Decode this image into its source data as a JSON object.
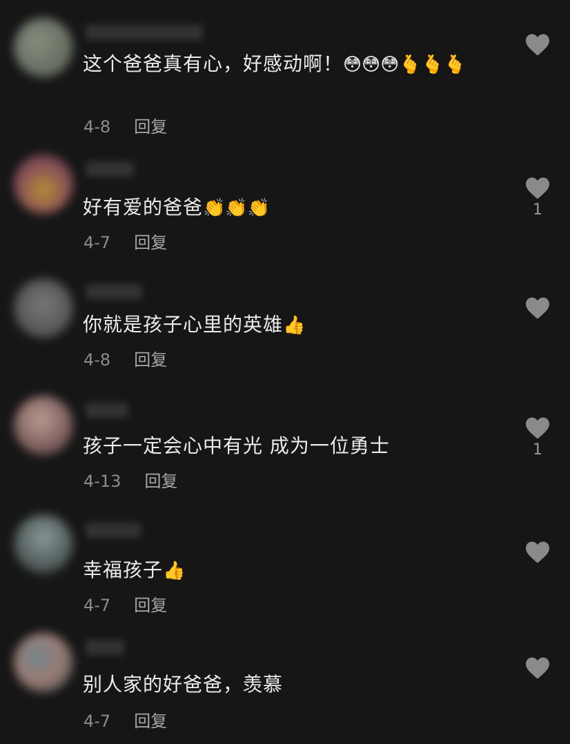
{
  "comments": [
    {
      "text": "这个爸爸真有心，好感动啊！",
      "emojis": "😳😳😳🫰🫰🫰",
      "date": "4-8",
      "reply_label": "回复",
      "like_count": ""
    },
    {
      "text": "好有爱的爸爸",
      "emojis": "👏👏👏",
      "date": "4-7",
      "reply_label": "回复",
      "like_count": "1"
    },
    {
      "text": "你就是孩子心里的英雄",
      "emojis": "👍",
      "date": "4-8",
      "reply_label": "回复",
      "like_count": ""
    },
    {
      "text": "孩子一定会心中有光 成为一位勇士",
      "emojis": "",
      "date": "4-13",
      "reply_label": "回复",
      "like_count": "1"
    },
    {
      "text": "幸福孩子",
      "emojis": "👍",
      "date": "4-7",
      "reply_label": "回复",
      "like_count": ""
    },
    {
      "text": "别人家的好爸爸，羡慕",
      "emojis": "",
      "date": "4-7",
      "reply_label": "回复",
      "like_count": ""
    }
  ],
  "icons": {
    "like": "heart-icon"
  },
  "colors": {
    "background": "#161616",
    "text": "#ececec",
    "meta": "#8c8c8c",
    "heart": "#8a8a8a"
  }
}
